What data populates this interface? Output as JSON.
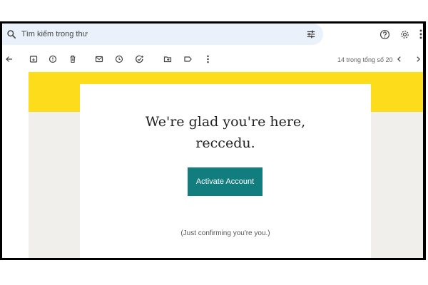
{
  "search": {
    "placeholder": "Tìm kiếm trong thư"
  },
  "toolbar": {
    "pager_text": "14 trong tổng số 20"
  },
  "email": {
    "headline_line1": "We're glad you're here,",
    "headline_line2": "reccedu.",
    "activate_label": "Activate Account",
    "confirm_note": "(Just confirming you're you.)"
  },
  "colors": {
    "brand_yellow": "#fddc1b",
    "button_teal": "#127d7e",
    "search_bg": "#eaf1fb"
  },
  "icons": [
    "search-icon",
    "tune-icon",
    "help-icon",
    "gear-icon",
    "more-vert-icon",
    "back-arrow-icon",
    "archive-icon",
    "report-spam-icon",
    "delete-icon",
    "mark-unread-icon",
    "snooze-icon",
    "add-task-icon",
    "move-to-icon",
    "label-icon",
    "chevron-left-icon",
    "chevron-right-icon"
  ]
}
